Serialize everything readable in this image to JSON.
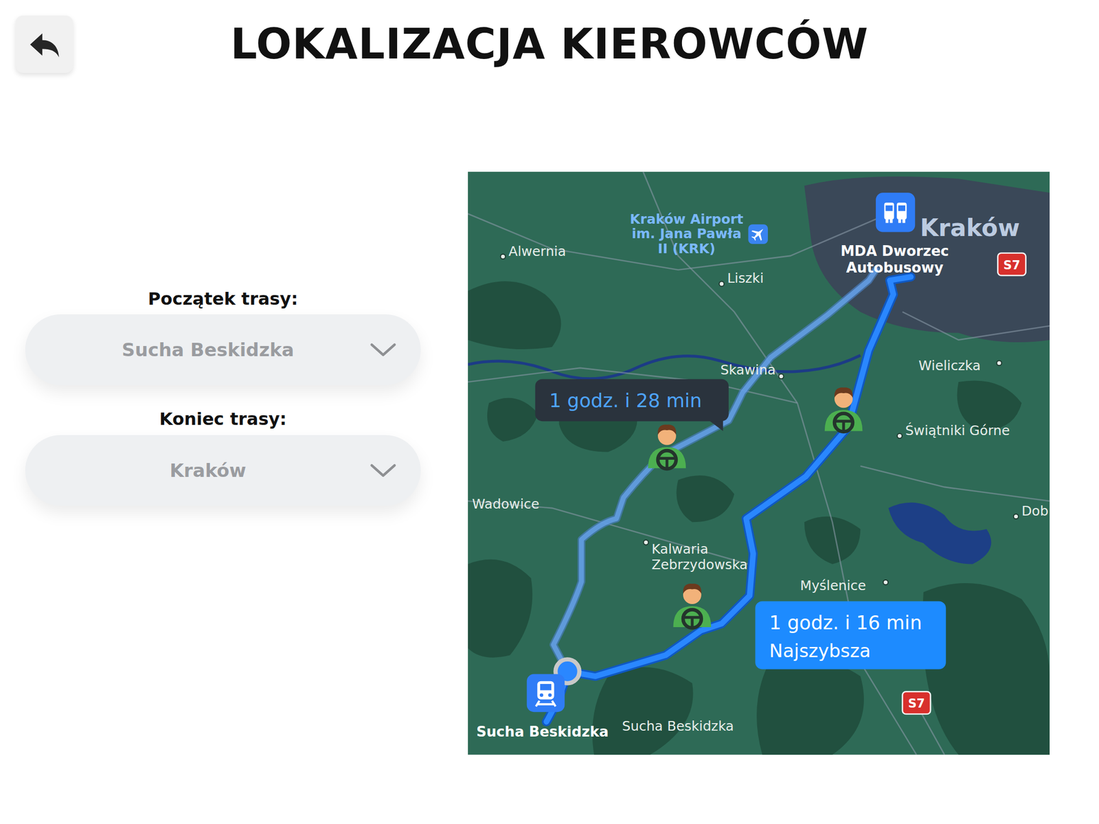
{
  "header": {
    "title": "LOKALIZACJA KIEROWCÓW"
  },
  "route_form": [
    {
      "label": "Początek trasy:",
      "value": "Sucha Beskidzka"
    },
    {
      "label": "Koniec trasy:",
      "value": "Kraków"
    }
  ],
  "map": {
    "places": [
      {
        "lines": [
          "Alwernia"
        ],
        "kind": "town"
      },
      {
        "lines": [
          "Kraków Airport",
          "im. Jana Pawła",
          "II (KRK)"
        ],
        "kind": "poi"
      },
      {
        "lines": [
          "Liszki"
        ],
        "kind": "town"
      },
      {
        "lines": [
          "Kraków"
        ],
        "kind": "city"
      },
      {
        "lines": [
          "MDA Dworzec",
          "Autobusowy"
        ],
        "kind": "transit"
      },
      {
        "lines": [
          "Skawina"
        ],
        "kind": "town"
      },
      {
        "lines": [
          "Wieliczka"
        ],
        "kind": "town"
      },
      {
        "lines": [
          "Świątniki Górne"
        ],
        "kind": "town"
      },
      {
        "lines": [
          "Wadowice"
        ],
        "kind": "town"
      },
      {
        "lines": [
          "Kalwaria",
          "Zebrzydowska"
        ],
        "kind": "town"
      },
      {
        "lines": [
          "Myślenice"
        ],
        "kind": "town"
      },
      {
        "lines": [
          "Dob"
        ],
        "kind": "town"
      },
      {
        "lines": [
          "Sucha Beskidzka"
        ],
        "kind": "transit"
      },
      {
        "lines": [
          "Sucha Beskidzka"
        ],
        "kind": "town"
      }
    ],
    "routes": [
      {
        "duration": "1 godz. i 28 min",
        "selected": false
      },
      {
        "duration": "1 godz. i 16 min",
        "note": "Najszybsza",
        "selected": true
      }
    ],
    "road_badges": [
      "S7",
      "S7"
    ]
  }
}
